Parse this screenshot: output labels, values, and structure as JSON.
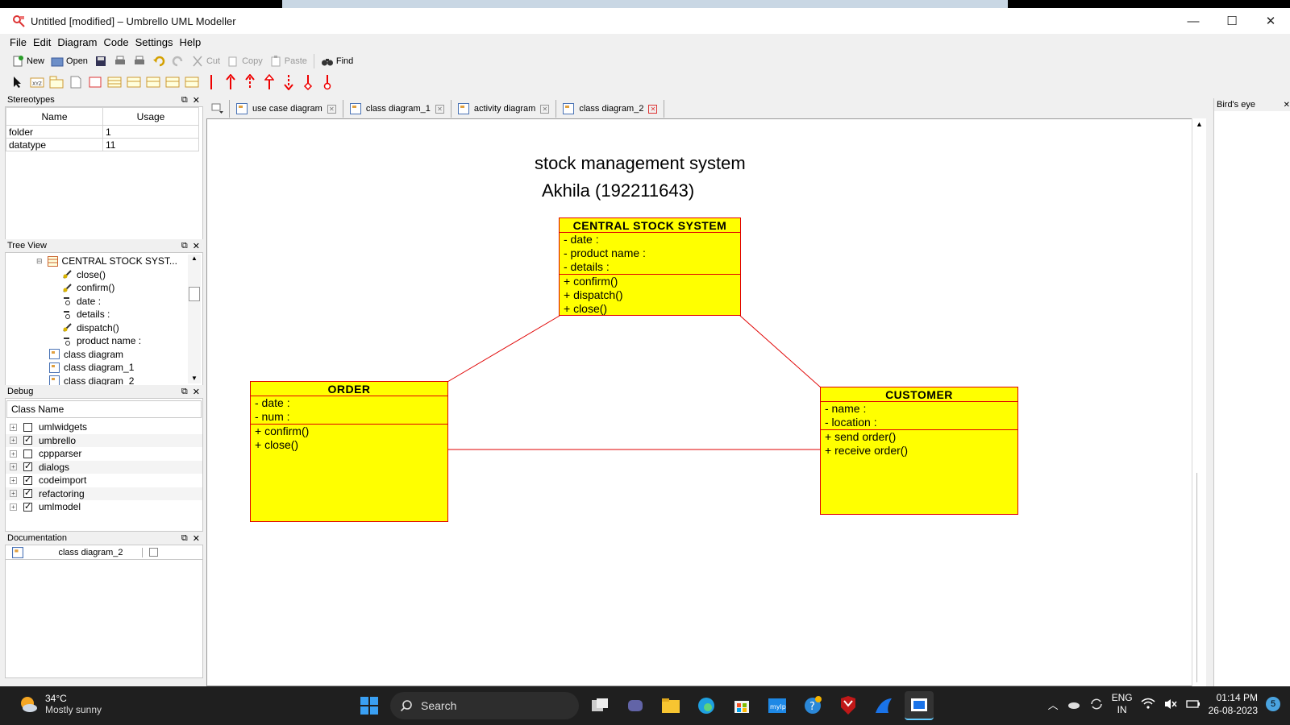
{
  "window": {
    "title": "Untitled [modified] – Umbrello UML Modeller",
    "minimize": "—",
    "maximize": "☐",
    "close": "✕"
  },
  "menu": [
    "File",
    "Edit",
    "Diagram",
    "Code",
    "Settings",
    "Help"
  ],
  "toolbar": {
    "new": "New",
    "open": "Open",
    "cut": "Cut",
    "copy": "Copy",
    "paste": "Paste",
    "find": "Find"
  },
  "stereotypes": {
    "title": "Stereotypes",
    "columns": [
      "Name",
      "Usage"
    ],
    "rows": [
      {
        "name": "folder",
        "usage": "1"
      },
      {
        "name": "datatype",
        "usage": "11"
      }
    ]
  },
  "tree_view": {
    "title": "Tree View",
    "items": [
      "CENTRAL STOCK SYST...",
      "close()",
      "confirm()",
      "date :",
      "details :",
      "dispatch()",
      "product name :",
      "class diagram",
      "class diagram_1",
      "class diagram_2"
    ]
  },
  "debug": {
    "title": "Debug",
    "column": "Class Name",
    "items": [
      {
        "label": "umlwidgets",
        "checked": false
      },
      {
        "label": "umbrello",
        "checked": true
      },
      {
        "label": "cppparser",
        "checked": false
      },
      {
        "label": "dialogs",
        "checked": true
      },
      {
        "label": "codeimport",
        "checked": true
      },
      {
        "label": "refactoring",
        "checked": true
      },
      {
        "label": "umlmodel",
        "checked": true
      }
    ]
  },
  "documentation": {
    "title": "Documentation",
    "value": "class diagram_2"
  },
  "birds_eye": {
    "title": "Bird's eye"
  },
  "tabs": [
    "use case diagram",
    "class diagram_1",
    "activity diagram",
    "class diagram_2"
  ],
  "active_tab": 3,
  "diagram": {
    "title": "stock management system",
    "subtitle": "Akhila (192211643)",
    "classes": {
      "central": {
        "name": "CENTRAL STOCK SYSTEM",
        "attributes": [
          "- date :",
          "- product name :",
          "- details :"
        ],
        "operations": [
          "+ confirm()",
          "+ dispatch()",
          "+ close()"
        ]
      },
      "order": {
        "name": "ORDER",
        "attributes": [
          "- date :",
          "- num :"
        ],
        "operations": [
          "+ confirm()",
          "+ close()"
        ]
      },
      "customer": {
        "name": "CUSTOMER",
        "attributes": [
          "- name :",
          "- location :"
        ],
        "operations": [
          "+ send order()",
          "+ receive order()"
        ]
      }
    }
  },
  "taskbar": {
    "temperature": "34°C",
    "weather": "Mostly sunny",
    "search": "Search",
    "language": "ENG",
    "region": "IN",
    "time": "01:14 PM",
    "date": "26-08-2023",
    "notifications": "5"
  },
  "colors": {
    "uml_fill": "#ffff00",
    "uml_border": "#e00000",
    "association": "#e00000"
  }
}
